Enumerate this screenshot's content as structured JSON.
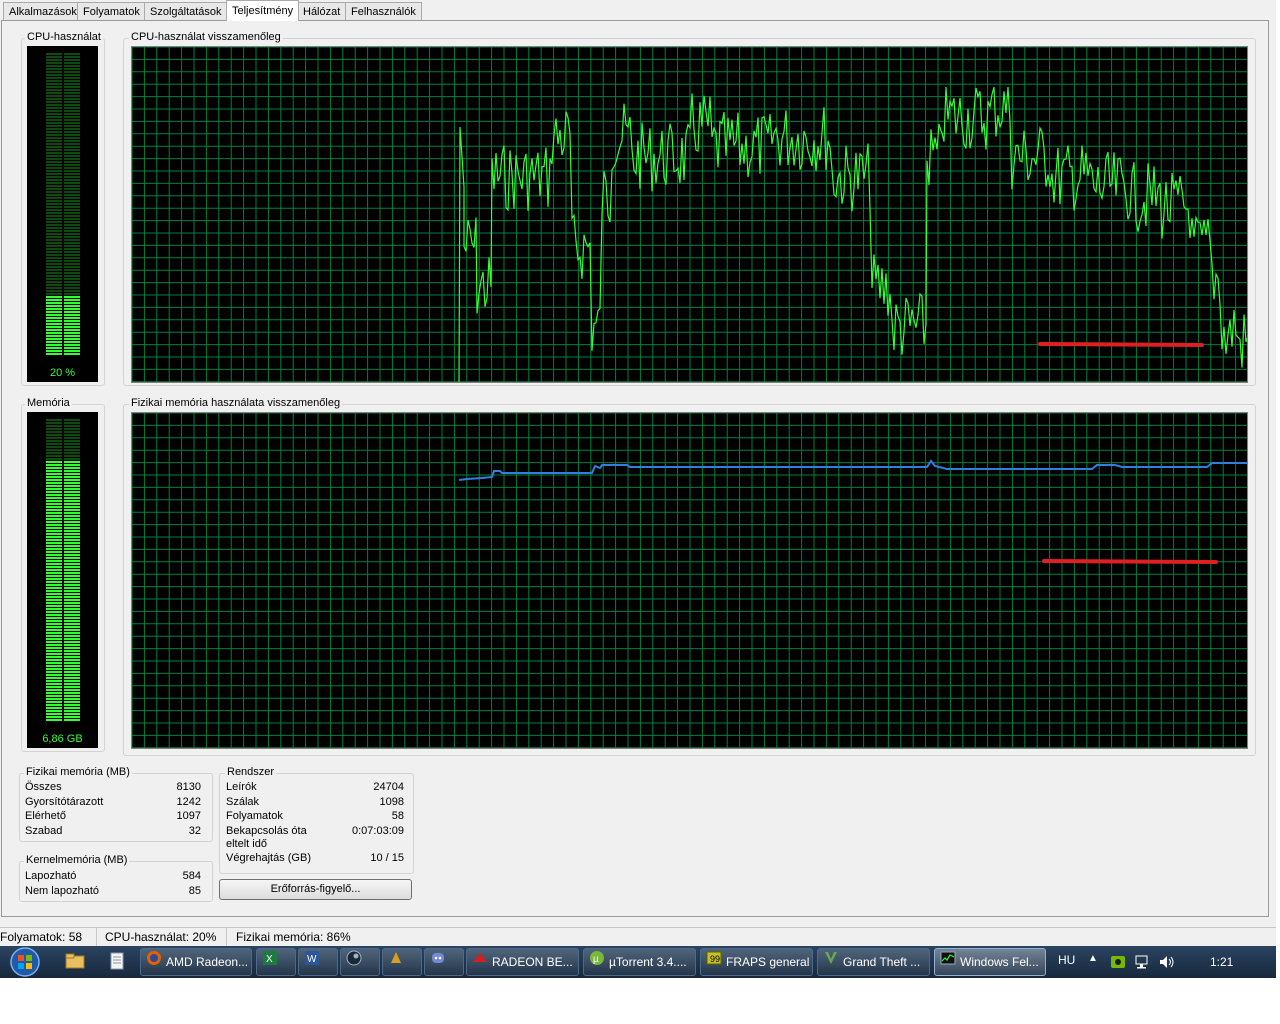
{
  "tabs": [
    {
      "label": "Alkalmazások"
    },
    {
      "label": "Folyamatok"
    },
    {
      "label": "Szolgáltatások"
    },
    {
      "label": "Teljesítmény",
      "active": true
    },
    {
      "label": "Hálózat"
    },
    {
      "label": "Felhasználók"
    }
  ],
  "cpu": {
    "meter_title": "CPU-használat",
    "meter_value": "20 %",
    "meter_level": 0.2,
    "history_title": "CPU-használat visszamenőleg",
    "line_color": "#33ff33"
  },
  "memory": {
    "meter_title": "Memória",
    "meter_value": "6,86 GB",
    "meter_level": 0.86,
    "history_title": "Fizikai memória használata visszamenőleg",
    "line_color": "#2f7fe0"
  },
  "annotation_color": "#e02020",
  "physical_memory": {
    "title": "Fizikai memória (MB)",
    "rows": [
      {
        "label": "Összes",
        "value": "8130"
      },
      {
        "label": "Gyorsítótárazott",
        "value": "1242"
      },
      {
        "label": "Elérhető",
        "value": "1097"
      },
      {
        "label": "Szabad",
        "value": "32"
      }
    ]
  },
  "kernel_memory": {
    "title": "Kernelmemória (MB)",
    "rows": [
      {
        "label": "Lapozható",
        "value": "584"
      },
      {
        "label": "Nem lapozható",
        "value": "85"
      }
    ]
  },
  "system": {
    "title": "Rendszer",
    "rows": [
      {
        "label": "Leírók",
        "value": "24704"
      },
      {
        "label": "Szálak",
        "value": "1098"
      },
      {
        "label": "Folyamatok",
        "value": "58"
      },
      {
        "label": "Bekapcsolás óta",
        "label2": "eltelt idő",
        "value": "0:07:03:09"
      },
      {
        "label": "Végrehajtás (GB)",
        "value": "10 / 15"
      }
    ]
  },
  "resource_monitor_button": "Erőforrás-figyelő...",
  "statusbar": {
    "processes": "Folyamatok: 58",
    "cpu": "CPU-használat: 20%",
    "memory": "Fizikai memória: 86%"
  },
  "taskbar": {
    "start_icon": "windows-start-orb",
    "pinned": [
      {
        "icon": "folder-icon"
      },
      {
        "icon": "document-icon"
      }
    ],
    "buttons": [
      {
        "label": "AMD Radeon...",
        "icon": "firefox-icon"
      },
      {
        "label": "",
        "icon": "excel-icon"
      },
      {
        "label": "",
        "icon": "word-icon"
      },
      {
        "label": "",
        "icon": "steam-icon"
      },
      {
        "label": "",
        "icon": "winamp-icon"
      },
      {
        "label": "",
        "icon": "discord-icon"
      },
      {
        "label": "RADEON BE...",
        "icon": "radeon-icon"
      },
      {
        "label": "µTorrent 3.4....",
        "icon": "utorrent-icon"
      },
      {
        "label": "FRAPS general",
        "icon": "fraps-icon"
      },
      {
        "label": "Grand Theft ...",
        "icon": "gta-icon"
      },
      {
        "label": "Windows Fel...",
        "icon": "task-manager-icon",
        "active": true
      }
    ],
    "language": "HU",
    "clock": "1:21"
  }
}
